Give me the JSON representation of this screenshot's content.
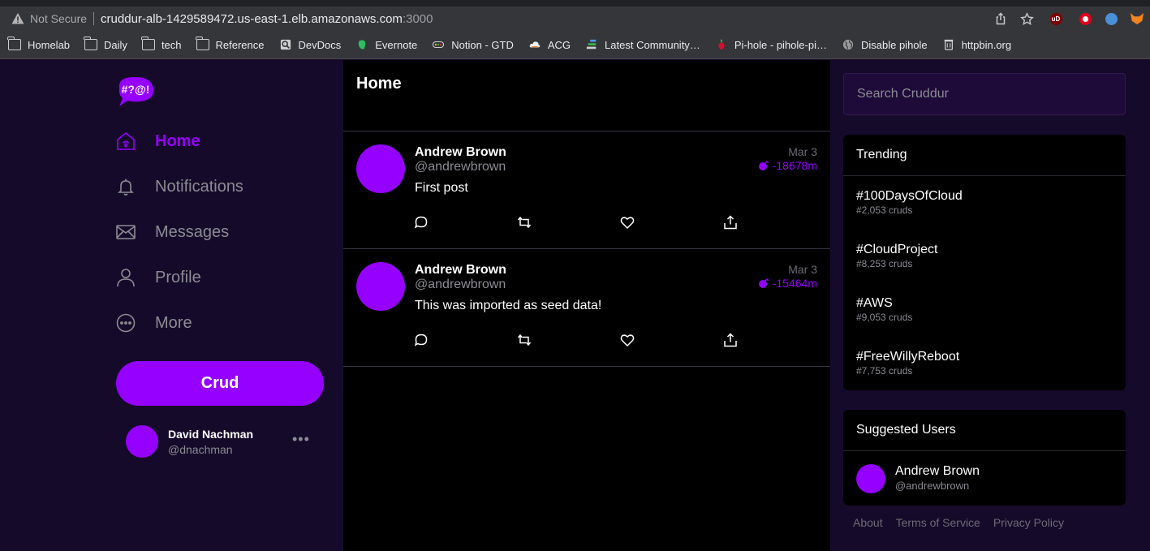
{
  "browser": {
    "security_label": "Not Secure",
    "url_host": "cruddur-alb-1429589472.us-east-1.elb.amazonaws.com",
    "url_port": ":3000",
    "ext_ud_label": "uD",
    "bookmarks": [
      {
        "label": "Homelab",
        "icon": "folder-icon"
      },
      {
        "label": "Daily",
        "icon": "folder-icon"
      },
      {
        "label": "tech",
        "icon": "folder-icon"
      },
      {
        "label": "Reference",
        "icon": "folder-icon"
      },
      {
        "label": "DevDocs",
        "icon": "devdocs-icon"
      },
      {
        "label": "Evernote",
        "icon": "evernote-icon"
      },
      {
        "label": "Notion - GTD",
        "icon": "notion-icon"
      },
      {
        "label": "ACG",
        "icon": "acg-icon"
      },
      {
        "label": "Latest Community…",
        "icon": "community-icon"
      },
      {
        "label": "Pi-hole - pihole-pi…",
        "icon": "pihole-icon"
      },
      {
        "label": "Disable pihole",
        "icon": "globe-icon"
      },
      {
        "label": "httpbin.org",
        "icon": "httpbin-icon"
      }
    ]
  },
  "brand": {
    "logo_text": "#?@!",
    "accent": "#9500ff"
  },
  "nav": {
    "items": [
      {
        "label": "Home",
        "icon": "home-icon",
        "active": true
      },
      {
        "label": "Notifications",
        "icon": "bell-icon"
      },
      {
        "label": "Messages",
        "icon": "mail-icon"
      },
      {
        "label": "Profile",
        "icon": "person-icon"
      },
      {
        "label": "More",
        "icon": "more-circle-icon"
      }
    ],
    "crud_button": "Crud"
  },
  "current_user": {
    "name": "David Nachman",
    "handle": "@dnachman",
    "menu": "•••"
  },
  "feed": {
    "title": "Home",
    "posts": [
      {
        "name": "Andrew Brown",
        "handle": "@andrewbrown",
        "date": "Mar 3",
        "expires": "-18678m",
        "body": "First post"
      },
      {
        "name": "Andrew Brown",
        "handle": "@andrewbrown",
        "date": "Mar 3",
        "expires": "-15464m",
        "body": "This was imported as seed data!"
      }
    ]
  },
  "sidebar": {
    "search_placeholder": "Search Cruddur",
    "trending": {
      "title": "Trending",
      "items": [
        {
          "tag": "#100DaysOfCloud",
          "count": "#2,053 cruds"
        },
        {
          "tag": "#CloudProject",
          "count": "#8,253 cruds"
        },
        {
          "tag": "#AWS",
          "count": "#9,053 cruds"
        },
        {
          "tag": "#FreeWillyReboot",
          "count": "#7,753 cruds"
        }
      ]
    },
    "suggested": {
      "title": "Suggested Users",
      "users": [
        {
          "name": "Andrew Brown",
          "handle": "@andrewbrown"
        }
      ]
    },
    "footer": [
      "About",
      "Terms of Service",
      "Privacy Policy"
    ]
  }
}
